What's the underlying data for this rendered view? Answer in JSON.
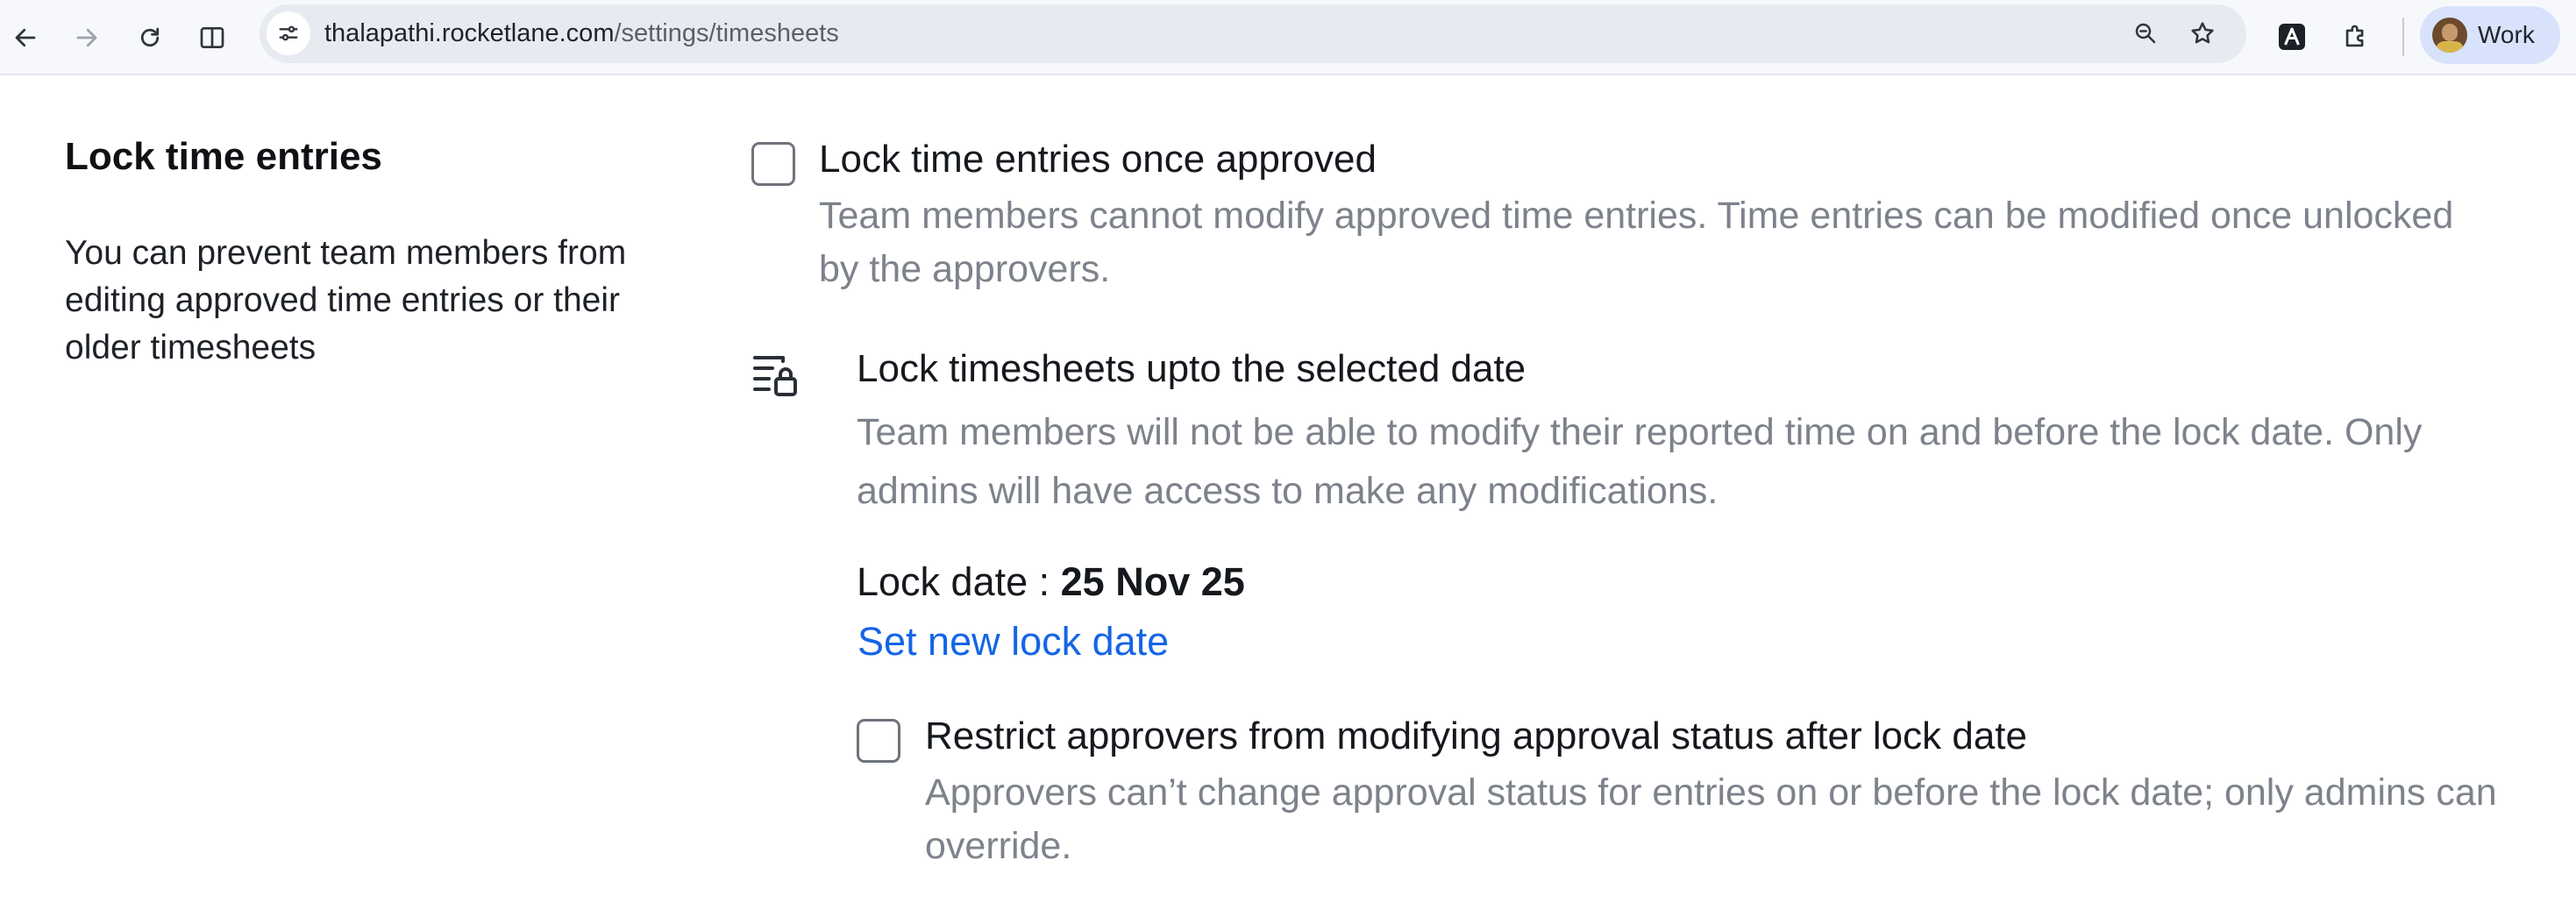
{
  "browser": {
    "url_host": "thalapathi.rocketlane.com",
    "url_path": "/settings/timesheets",
    "profile_label": "Work",
    "icons": {
      "back": "arrow-left-icon",
      "forward": "arrow-right-icon",
      "reload": "reload-icon",
      "split": "split-view-icon",
      "site_info": "tune-icon",
      "zoom": "zoom-icon",
      "bookmark": "star-icon",
      "extension_app": "rocketlane-extension-icon",
      "extensions": "puzzle-icon"
    }
  },
  "section": {
    "title": "Lock time entries",
    "description": "You can prevent team members from editing approved time entries or their older timesheets"
  },
  "option_lock_approved": {
    "title": "Lock time entries once approved",
    "description": "Team members cannot modify approved time entries. Time entries can be modified once unlocked by the approvers.",
    "checked": false
  },
  "option_lock_timesheets": {
    "title": "Lock timesheets upto the selected date",
    "description": "Team members will not be able to modify their reported time on and before the lock date. Only admins will have access to make any modifications.",
    "icon": "timesheet-lock-icon",
    "lock_date_label": "Lock date : ",
    "lock_date_value": "25 Nov 25",
    "set_date_link": "Set new lock date"
  },
  "option_restrict_approvers": {
    "title": "Restrict approvers from modifying approval status after lock date",
    "description": "Approvers can’t change approval status for entries on or before the lock date; only admins can override.",
    "checked": false
  },
  "colors": {
    "link": "#1565e6",
    "muted_text": "#7d828b",
    "chrome_bg": "#f7f8fc",
    "omnibox_bg": "#e8eaf2",
    "profile_chip_bg": "#d8e3fb"
  }
}
